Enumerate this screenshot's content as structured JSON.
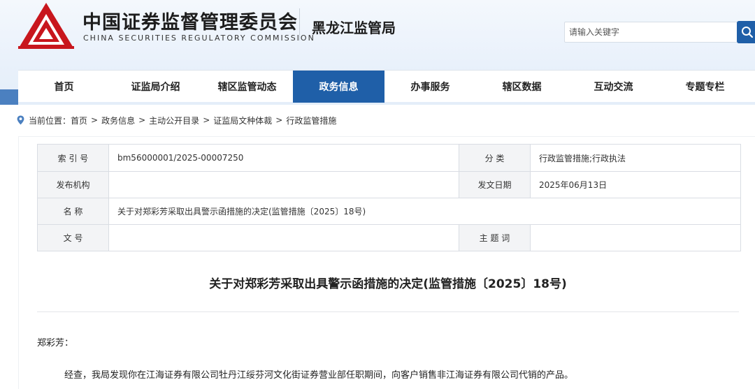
{
  "header": {
    "org_name_cn": "中国证券监督管理委员会",
    "org_name_en": "CHINA SECURITIES REGULATORY COMMISSION",
    "bureau": "黑龙江监管局",
    "logo_color": "#c8161d"
  },
  "search": {
    "placeholder": "请输入关键字",
    "button_icon": "search-icon",
    "button_color": "#1f5fa8"
  },
  "nav": {
    "items": [
      {
        "label": "首页"
      },
      {
        "label": "证监局介绍"
      },
      {
        "label": "辖区监管动态"
      },
      {
        "label": "政务信息",
        "active": true
      },
      {
        "label": "办事服务"
      },
      {
        "label": "辖区数据"
      },
      {
        "label": "互动交流"
      },
      {
        "label": "专题专栏"
      }
    ],
    "active_color": "#1f5fa8"
  },
  "breadcrumb": {
    "icon": "location-pin-icon",
    "prefix": "当前位置：",
    "items": [
      "首页",
      "政务信息",
      "主动公开目录",
      "证监局文种体裁",
      "行政监管措施"
    ],
    "separator": ">"
  },
  "meta": {
    "index_label": "索 引 号",
    "index_value": "bm56000001/2025-00007250",
    "category_label": "分 类",
    "category_value": "行政监管措施;行政执法",
    "issuer_label": "发布机构",
    "issuer_value": "",
    "date_label": "发文日期",
    "date_value": "2025年06月13日",
    "name_label": "名 称",
    "name_value": "关于对郑彩芳采取出具警示函措施的决定(监管措施〔2025〕18号)",
    "docno_label": "文 号",
    "docno_value": "",
    "keywords_label": "主 题 词",
    "keywords_value": ""
  },
  "document": {
    "title": "关于对郑彩芳采取出具警示函措施的决定(监管措施〔2025〕18号)",
    "addressee": "郑彩芳：",
    "paragraph_1": "经查，我局发现你在江海证券有限公司牡丹江绥芬河文化街证券营业部任职期间，向客户销售非江海证券有限公司代销的产品。"
  }
}
